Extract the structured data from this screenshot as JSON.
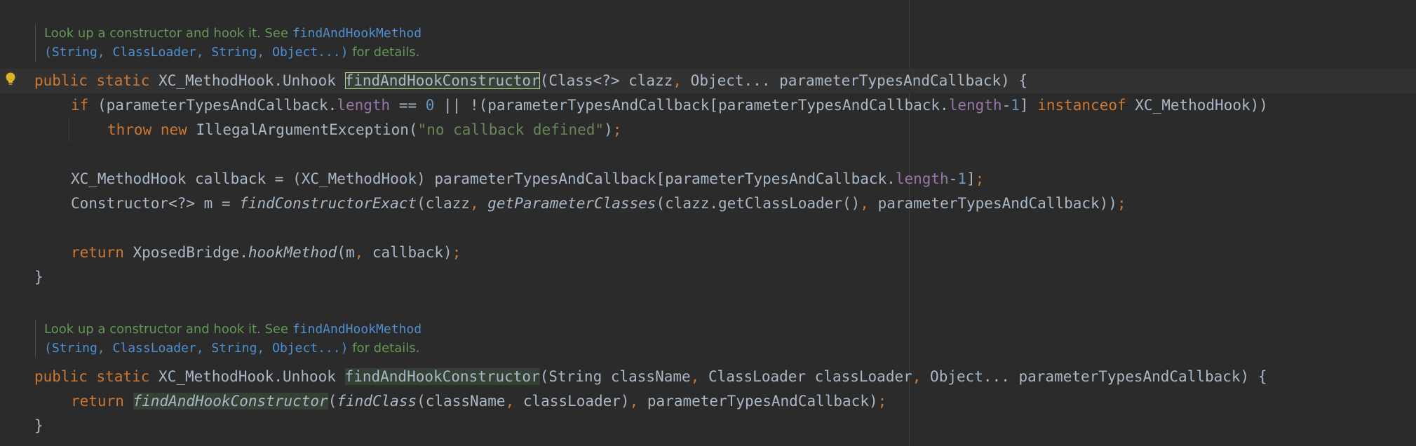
{
  "doc1": {
    "text1": "Look up a constructor and hook it. See ",
    "link": "findAndHookMethod",
    "params": "(String, ClassLoader, String, Object...)",
    "text2": " for details."
  },
  "line1": {
    "kw1": "public",
    "kw2": "static",
    "type": "XC_MethodHook.Unhook",
    "method": "findAndHookConstructor",
    "params": "(Class<?> clazz",
    "comma": ",",
    "params2": " Object... parameterTypesAndCallback) {"
  },
  "line2": {
    "kw": "if",
    "p1": " (parameterTypesAndCallback.",
    "f1": "length",
    "p2": " == ",
    "n1": "0",
    "p3": " || !(parameterTypesAndCallback[parameterTypesAndCallback.",
    "f2": "length",
    "p4": "-",
    "n2": "1",
    "p5": "] ",
    "kw2": "instanceof",
    "p6": " XC_MethodHook))"
  },
  "line3": {
    "kw1": "throw",
    "kw2": "new",
    "cls": " IllegalArgumentException(",
    "str": "\"no callback defined\"",
    "end": ")",
    "semi": ";"
  },
  "line4": {
    "p1": "XC_MethodHook callback = (XC_MethodHook) parameterTypesAndCallback[parameterTypesAndCallback.",
    "f": "length",
    "p2": "-",
    "n": "1",
    "p3": "]",
    "semi": ";"
  },
  "line5": {
    "p1": "Constructor<?> m = ",
    "m1": "findConstructorExact",
    "p2": "(clazz",
    "c1": ",",
    "sp1": " ",
    "m2": "getParameterClasses",
    "p3": "(clazz.getClassLoader()",
    "c2": ",",
    "p4": " parameterTypesAndCallback))",
    "semi": ";"
  },
  "line6": {
    "kw": "return",
    "p1": " XposedBridge.",
    "m": "hookMethod",
    "p2": "(m",
    "c": ",",
    "p3": " callback)",
    "semi": ";"
  },
  "brace1": "}",
  "doc2": {
    "text1": "Look up a constructor and hook it. See ",
    "link": "findAndHookMethod",
    "params": "(String, ClassLoader, String, Object...)",
    "text2": " for details."
  },
  "line7": {
    "kw1": "public",
    "kw2": "static",
    "type": "XC_MethodHook.Unhook",
    "method": "findAndHookConstructor",
    "p1": "(String className",
    "c1": ",",
    "p2": " ClassLoader classLoader",
    "c2": ",",
    "p3": " Object... parameterTypesAndCallback) {"
  },
  "line8": {
    "kw": "return",
    "m1": "findAndHookConstructor",
    "p1": "(",
    "m2": "findClass",
    "p2": "(className",
    "c1": ",",
    "p3": " classLoader)",
    "c2": ",",
    "p4": " parameterTypesAndCallback)",
    "semi": ";"
  },
  "brace2": "}",
  "colors": {
    "background": "#2b2b2b",
    "keyword": "#cc7832",
    "doc": "#629755",
    "link": "#4f8fd1",
    "field": "#9876aa",
    "number": "#6897bb",
    "string": "#6a8759",
    "text": "#a9b7c6"
  },
  "icons": {
    "intention": "lightbulb-icon"
  }
}
